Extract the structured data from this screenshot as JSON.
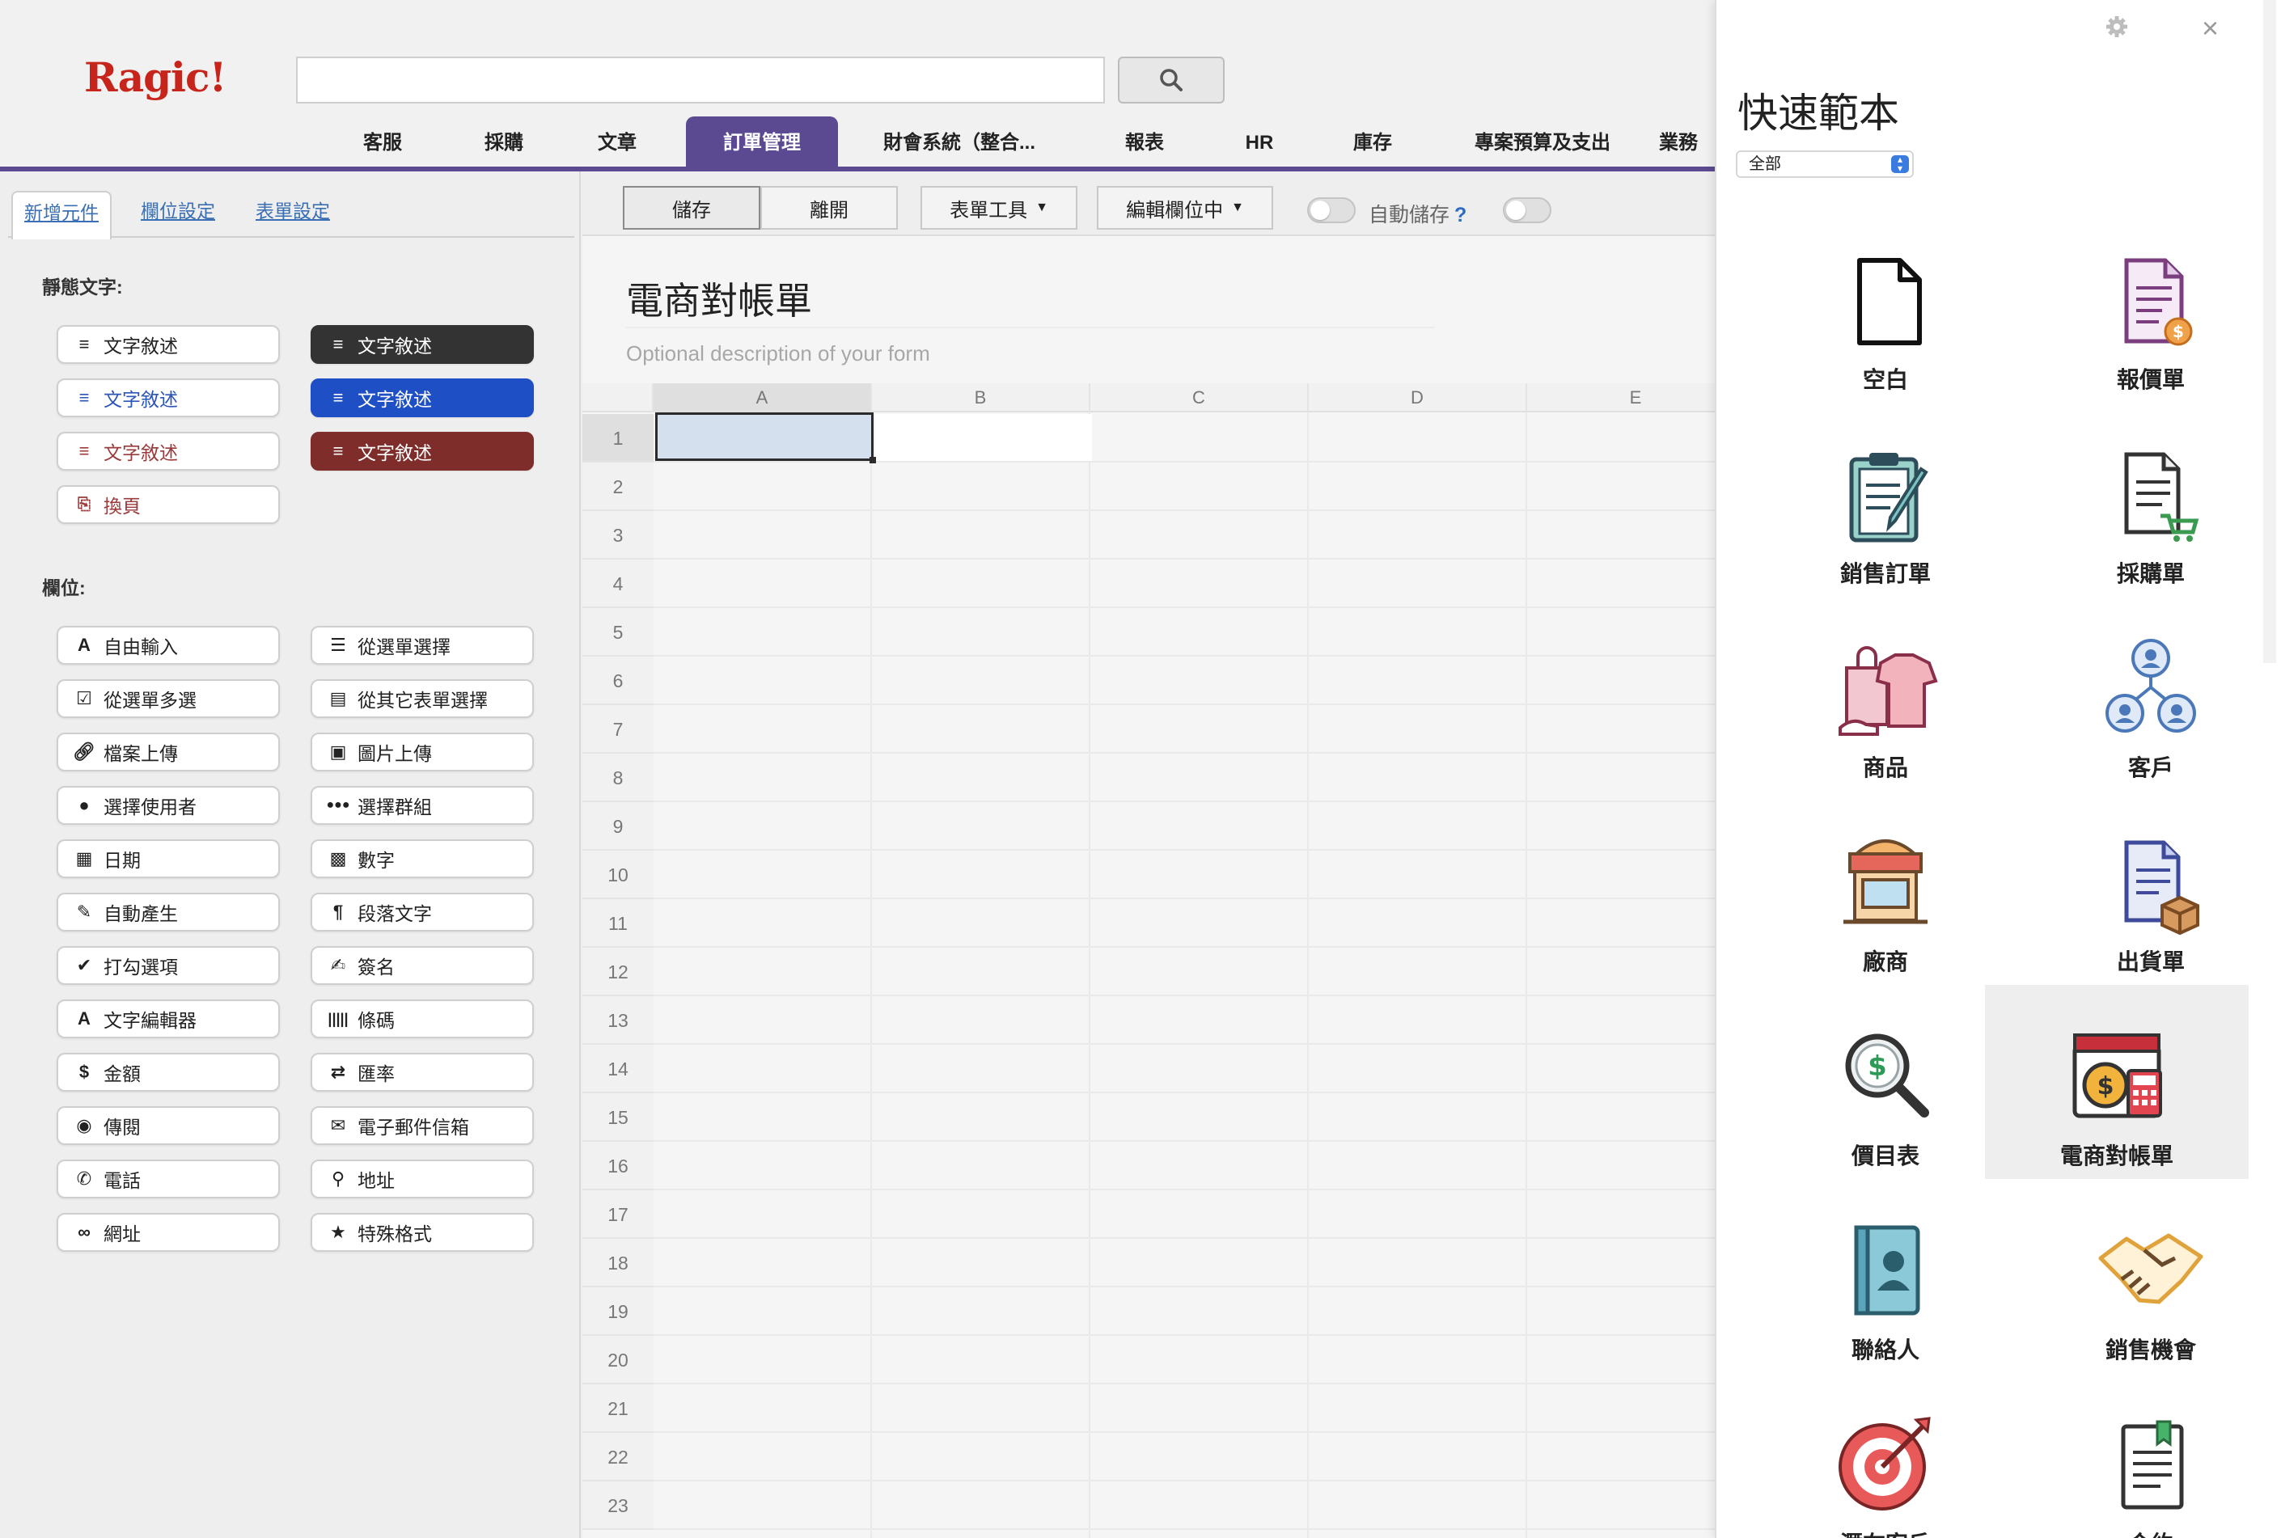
{
  "app": {
    "logo": "Ragic!"
  },
  "search": {
    "placeholder": ""
  },
  "nav_tabs": [
    "客服",
    "採購",
    "文章",
    "訂單管理",
    "財會系統（整合...",
    "報表",
    "HR",
    "庫存",
    "專案預算及支出",
    "業務"
  ],
  "nav_active": "訂單管理",
  "left_tabs": [
    "新增元件",
    "欄位設定",
    "表單設定"
  ],
  "static_text_label": "靜態文字:",
  "static_items": [
    {
      "label": "文字敘述",
      "style": "light"
    },
    {
      "label": "文字敘述",
      "style": "dark"
    },
    {
      "label": "文字敘述",
      "style": "blue-outline"
    },
    {
      "label": "文字敘述",
      "style": "blue"
    },
    {
      "label": "文字敘述",
      "style": "red-outline"
    },
    {
      "label": "文字敘述",
      "style": "red"
    },
    {
      "label": "換頁",
      "style": "red-outline"
    }
  ],
  "fields_label": "欄位:",
  "field_items": [
    {
      "label": "自由輸入",
      "icon": "letter-a-icon"
    },
    {
      "label": "從選單選擇",
      "icon": "list-icon"
    },
    {
      "label": "從選單多選",
      "icon": "checkbox-icon"
    },
    {
      "label": "從其它表單選擇",
      "icon": "table-list-icon"
    },
    {
      "label": "檔案上傳",
      "icon": "paperclip-icon"
    },
    {
      "label": "圖片上傳",
      "icon": "image-icon"
    },
    {
      "label": "選擇使用者",
      "icon": "user-icon"
    },
    {
      "label": "選擇群組",
      "icon": "group-icon"
    },
    {
      "label": "日期",
      "icon": "calendar-icon"
    },
    {
      "label": "數字",
      "icon": "calculator-icon"
    },
    {
      "label": "自動產生",
      "icon": "magic-wand-icon"
    },
    {
      "label": "段落文字",
      "icon": "paragraph-icon"
    },
    {
      "label": "打勾選項",
      "icon": "checkmark-icon"
    },
    {
      "label": "簽名",
      "icon": "edit-icon"
    },
    {
      "label": "文字編輯器",
      "icon": "letter-a-icon"
    },
    {
      "label": "條碼",
      "icon": "barcode-icon"
    },
    {
      "label": "金額",
      "icon": "dollar-icon"
    },
    {
      "label": "匯率",
      "icon": "exchange-icon"
    },
    {
      "label": "傳閱",
      "icon": "eye-icon"
    },
    {
      "label": "電子郵件信箱",
      "icon": "envelope-icon"
    },
    {
      "label": "電話",
      "icon": "phone-icon"
    },
    {
      "label": "地址",
      "icon": "map-pin-icon"
    },
    {
      "label": "網址",
      "icon": "link-icon"
    },
    {
      "label": "特殊格式",
      "icon": "star-icon"
    }
  ],
  "toolbar": {
    "save": "儲存",
    "leave": "離開",
    "form_tools": "表單工具",
    "edit_fields": "編輯欄位中",
    "autosave": "自動儲存",
    "help": "?"
  },
  "form": {
    "title": "電商對帳單",
    "description_placeholder": "Optional description of your form"
  },
  "grid": {
    "columns": [
      "A",
      "B",
      "C",
      "D",
      "E"
    ],
    "rows": [
      "1",
      "2",
      "3",
      "4",
      "5",
      "6",
      "7",
      "8",
      "9",
      "10",
      "11",
      "12",
      "13",
      "14",
      "15",
      "16",
      "17",
      "18",
      "19",
      "20",
      "21",
      "22",
      "23"
    ]
  },
  "templates_panel": {
    "title": "快速範本",
    "filter": "全部",
    "items": [
      {
        "label": "空白",
        "icon": "blank-document-icon"
      },
      {
        "label": "報價單",
        "icon": "quotation-icon"
      },
      {
        "label": "銷售訂單",
        "icon": "clipboard-pencil-icon"
      },
      {
        "label": "採購單",
        "icon": "purchase-order-icon"
      },
      {
        "label": "商品",
        "icon": "shopping-products-icon"
      },
      {
        "label": "客戶",
        "icon": "customer-network-icon"
      },
      {
        "label": "廠商",
        "icon": "storefront-icon"
      },
      {
        "label": "出貨單",
        "icon": "shipping-document-icon"
      },
      {
        "label": "價目表",
        "icon": "price-magnifier-icon"
      },
      {
        "label": "電商對帳單",
        "icon": "ecommerce-statement-icon"
      },
      {
        "label": "聯絡人",
        "icon": "contact-book-icon"
      },
      {
        "label": "銷售機會",
        "icon": "handshake-icon"
      },
      {
        "label": "潛在客戶",
        "icon": "target-icon"
      },
      {
        "label": "合約",
        "icon": "contract-icon"
      }
    ],
    "selected": "電商對帳單"
  },
  "colors": {
    "brand_purple": "#5b4a91",
    "logo_red": "#c7241b",
    "link_blue": "#3a6fb3",
    "selected_cell": "#d5e0ee"
  }
}
